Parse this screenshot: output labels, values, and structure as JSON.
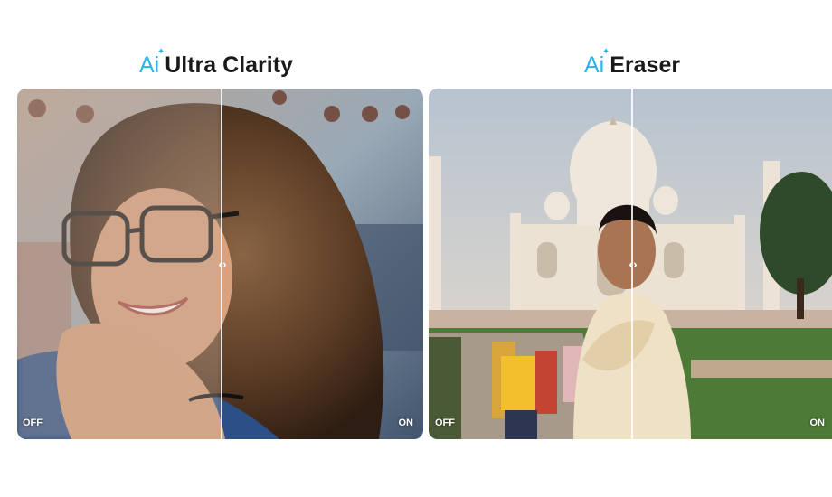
{
  "panels": [
    {
      "ai_label": "Ai",
      "title": "Ultra Clarity",
      "off_label": "OFF",
      "on_label": "ON"
    },
    {
      "ai_label": "Ai",
      "title": "Eraser",
      "off_label": "OFF",
      "on_label": "ON"
    }
  ],
  "colors": {
    "accent": "#2ab5e8",
    "title": "#1a1a1a"
  },
  "icons": {
    "ai_spark": "sparkle-icon",
    "divider_handle": "split-handle-icon"
  }
}
